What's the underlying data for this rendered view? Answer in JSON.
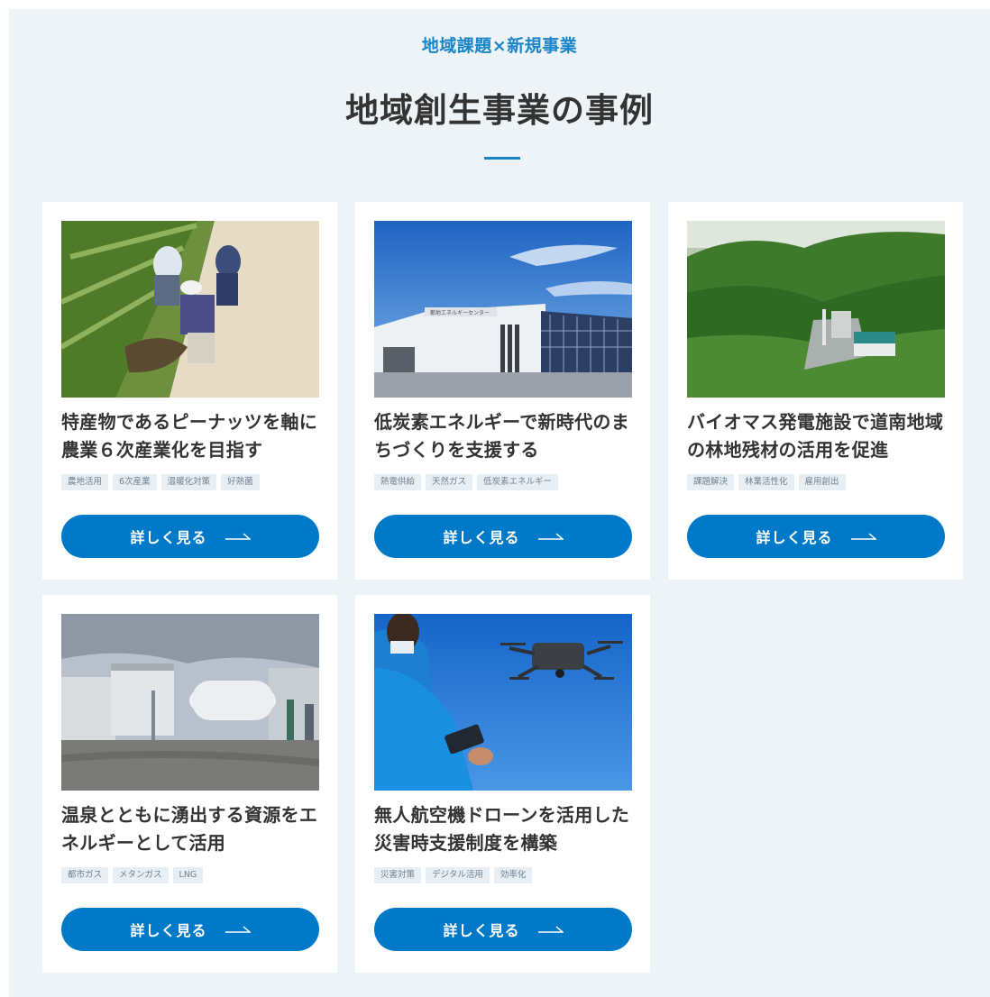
{
  "section": {
    "eyebrow": "地域課題×新規事業",
    "title": "地域創生事業の事例"
  },
  "cards": [
    {
      "title_line1": "特産物であるピーナッツを軸に",
      "title_line2": "農業６次産業化を目指す",
      "tags": [
        "農地活用",
        "6次産業",
        "温暖化対策",
        "好熱菌"
      ],
      "button_label": "詳しく見る"
    },
    {
      "title_line1": "低炭素エネルギーで新時代のま",
      "title_line2": "ちづくりを支援する",
      "tags": [
        "熱電供給",
        "天然ガス",
        "低炭素エネルギー"
      ],
      "button_label": "詳しく見る"
    },
    {
      "title_line1": "バイオマス発電施設で道南地域",
      "title_line2": "の林地残材の活用を促進",
      "tags": [
        "課題解決",
        "林業活性化",
        "雇用創出"
      ],
      "button_label": "詳しく見る"
    },
    {
      "title_line1": "温泉とともに湧出する資源をエ",
      "title_line2": "ネルギーとして活用",
      "tags": [
        "都市ガス",
        "メタンガス",
        "LNG"
      ],
      "button_label": "詳しく見る"
    },
    {
      "title_line1": "無人航空機ドローンを活用した",
      "title_line2": "災害時支援制度を構築",
      "tags": [
        "災害対策",
        "デジタル活用",
        "効率化"
      ],
      "button_label": "詳しく見る"
    }
  ],
  "building_sign": "都地エネルギーセンター",
  "colors": {
    "accent": "#0079c8",
    "eyebrow": "#1a84c8",
    "section_bg": "#eef3f7",
    "tag_bg": "#e7eef4"
  },
  "icons": [
    "arrow-right-icon"
  ]
}
